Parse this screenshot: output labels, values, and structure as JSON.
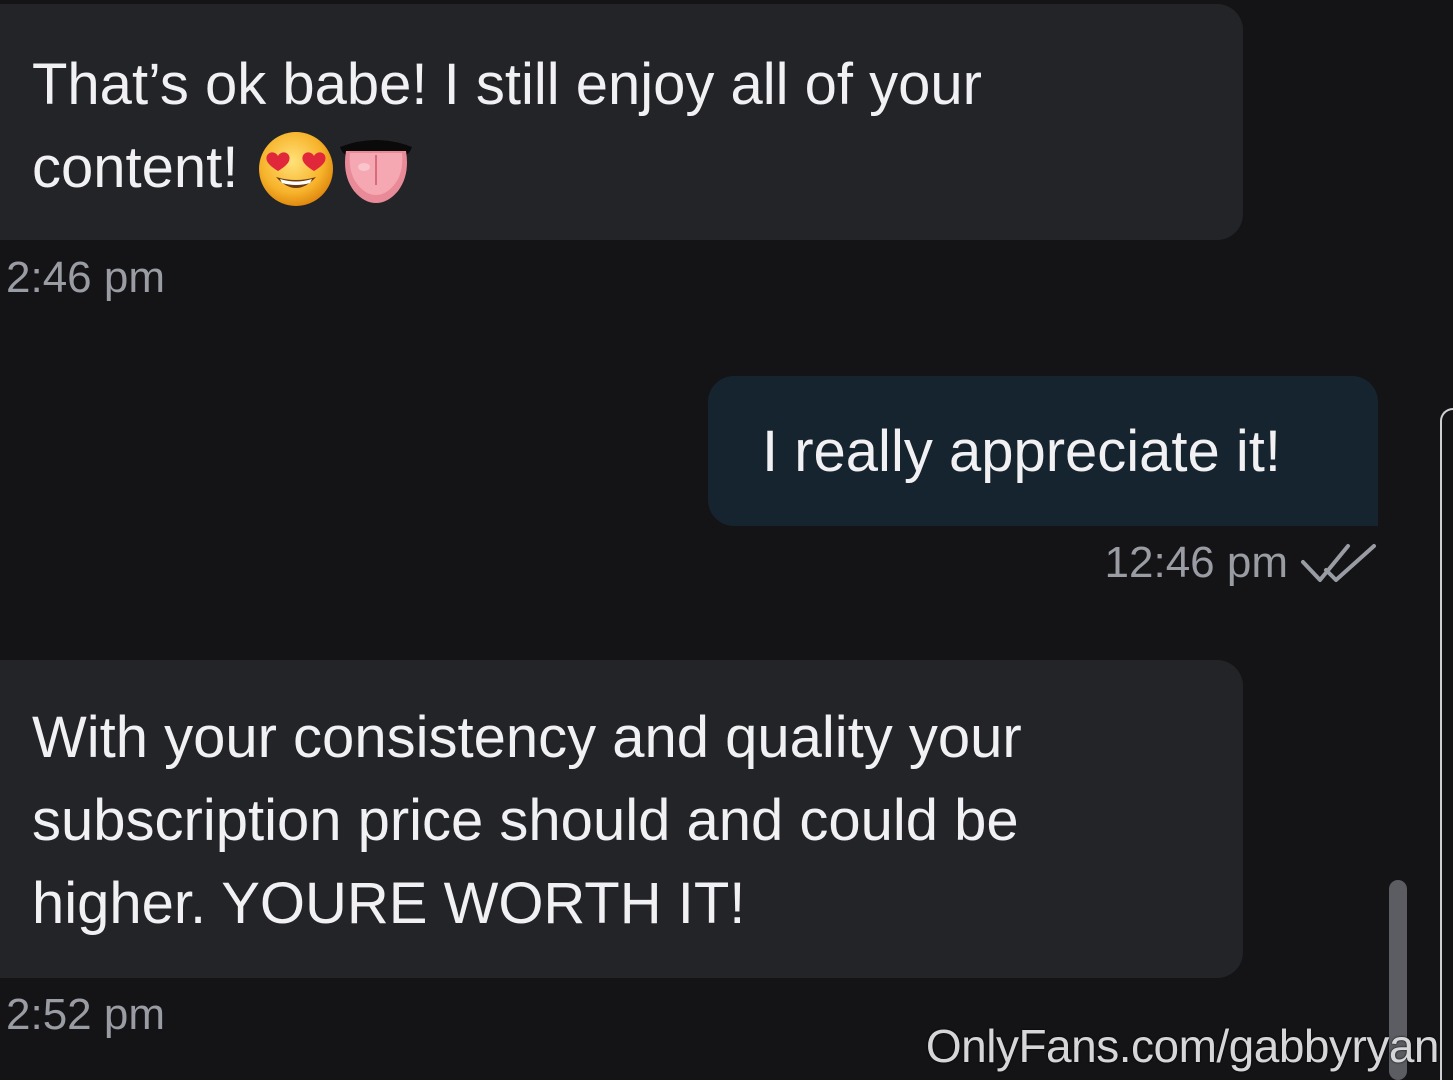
{
  "conversation": {
    "messages": [
      {
        "direction": "incoming",
        "lines": [
          "That’s ok babe! I still enjoy all of your",
          "content!"
        ],
        "emojis": [
          "heart-eyes-emoji",
          "tongue-emoji"
        ],
        "time": "2:46 pm"
      },
      {
        "direction": "outgoing",
        "lines": [
          "I really appreciate it!"
        ],
        "time": "12:46 pm",
        "status_icon": "double-check-icon"
      },
      {
        "direction": "incoming",
        "lines": [
          "With your consistency and quality your",
          "subscription price should and could be",
          "higher. YOURE WORTH IT!"
        ],
        "time": "2:52 pm"
      }
    ]
  },
  "watermark": "OnlyFans.com/gabbyryan",
  "colors": {
    "background": "#141417",
    "incoming_bubble": "#232428",
    "outgoing_bubble": "#16242f",
    "text": "#f1f1f3",
    "timestamp": "#9a9ca3"
  }
}
